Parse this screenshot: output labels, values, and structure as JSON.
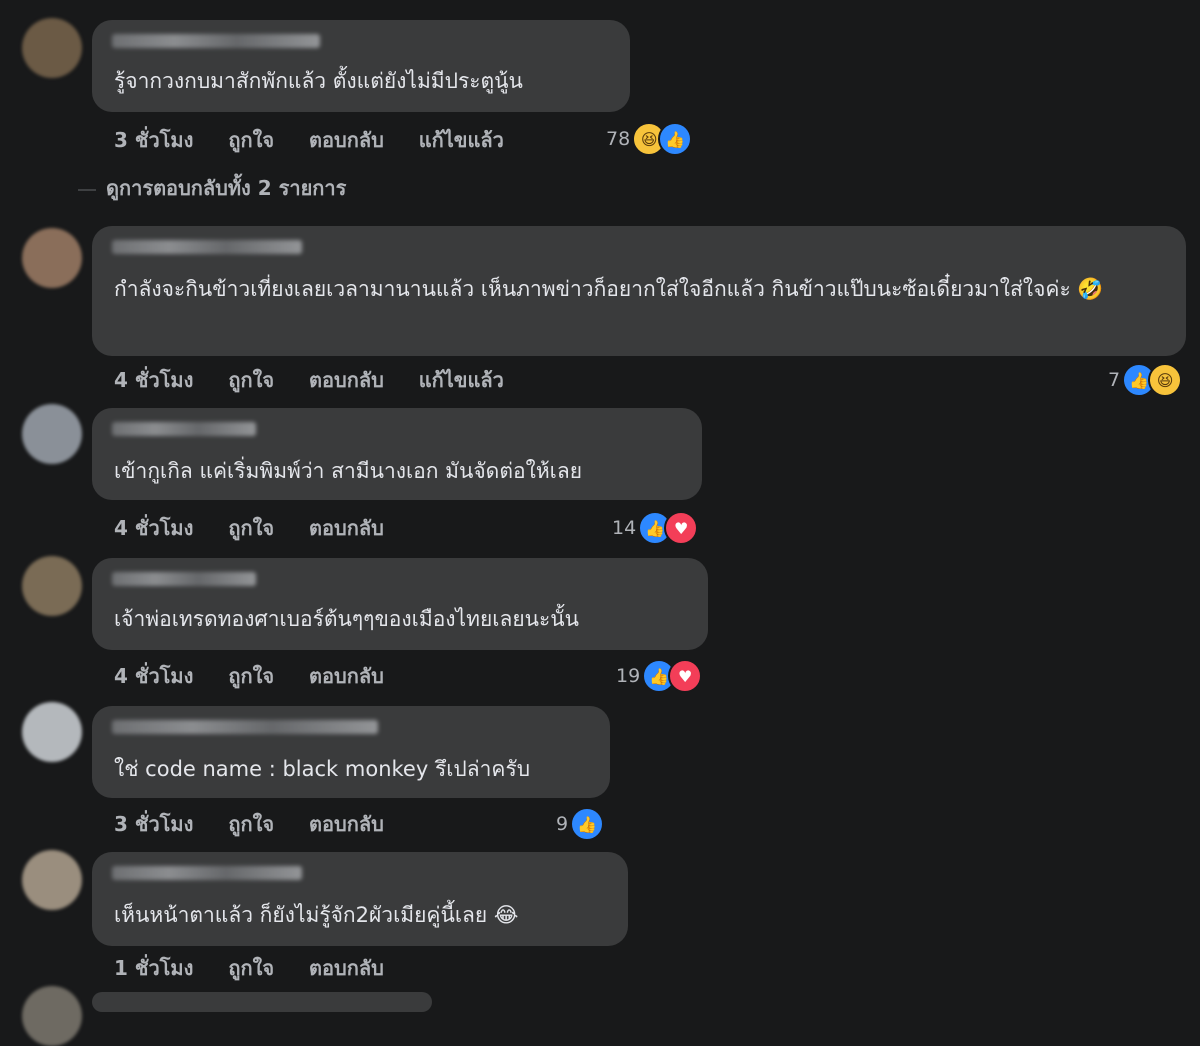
{
  "comments": [
    {
      "text": "รู้จากวงกบมาสักพักแล้ว ตั้งแต่ยังไม่มีประตูนู้น",
      "time": "3 ชั่วโมง",
      "like": "ถูกใจ",
      "reply": "ตอบกลับ",
      "edited": "แก้ไขแล้ว",
      "reaction_count": "78",
      "reactions": [
        "haha",
        "like"
      ]
    },
    {
      "text": "กำลังจะกินข้าวเที่ยงเลยเวลามานานแล้ว เห็นภาพข่าวก็อยากใส่ใจอีกแล้ว กินข้าวแป๊บนะซ้อเดี๋ยวมาใส่ใจค่ะ 🤣",
      "time": "4 ชั่วโมง",
      "like": "ถูกใจ",
      "reply": "ตอบกลับ",
      "edited": "แก้ไขแล้ว",
      "reaction_count": "7",
      "reactions": [
        "like",
        "haha"
      ]
    },
    {
      "text": "เข้ากูเกิล แค่เริ่มพิมพ์ว่า สามีนางเอก มันจัดต่อให้เลย",
      "time": "4 ชั่วโมง",
      "like": "ถูกใจ",
      "reply": "ตอบกลับ",
      "reaction_count": "14",
      "reactions": [
        "like",
        "love"
      ]
    },
    {
      "text": "เจ้าพ่อเทรดทองศาเบอร์ต้นๆๆของเมืองไทยเลยนะนั้น",
      "time": "4 ชั่วโมง",
      "like": "ถูกใจ",
      "reply": "ตอบกลับ",
      "reaction_count": "19",
      "reactions": [
        "like",
        "love"
      ]
    },
    {
      "text": "ใช่ code name : black monkey รึเปล่าครับ",
      "time": "3 ชั่วโมง",
      "like": "ถูกใจ",
      "reply": "ตอบกลับ",
      "reaction_count": "9",
      "reactions": [
        "like"
      ]
    },
    {
      "text": "เห็นหน้าตาแล้ว ก็ยังไม่รู้จัก2ผัวเมียคู่นี้เลย 😂",
      "time": "1 ชั่วโมง",
      "like": "ถูกใจ",
      "reply": "ตอบกลับ"
    }
  ],
  "view_replies": "ดูการตอบกลับทั้ง 2 รายการ",
  "colors": {
    "background": "#18191a",
    "bubble": "#3a3b3c",
    "like": "#2d88ff",
    "love": "#f33e58",
    "haha": "#f7c33b"
  }
}
